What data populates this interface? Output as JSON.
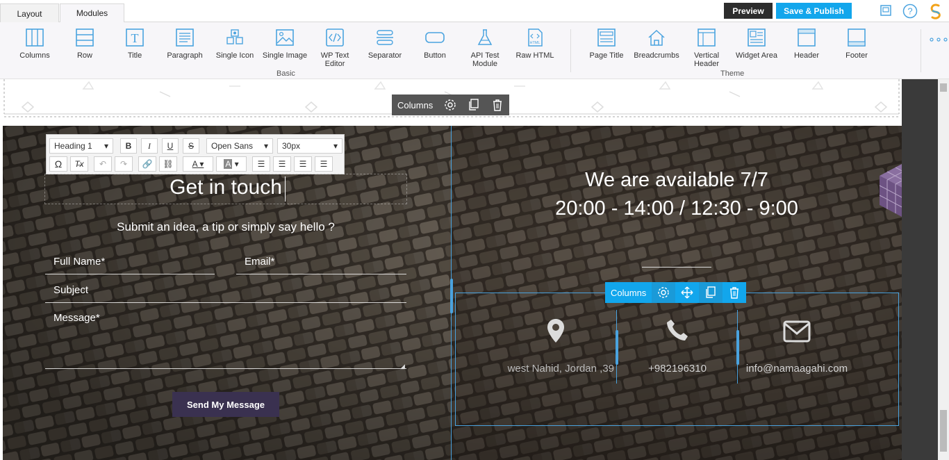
{
  "tabs": [
    {
      "label": "Layout"
    },
    {
      "label": "Modules"
    }
  ],
  "topbar": {
    "preview_label": "Preview",
    "publish_label": "Save & Publish"
  },
  "modules": {
    "basic": [
      {
        "label": "Columns",
        "icon": "columns-icon"
      },
      {
        "label": "Row",
        "icon": "row-icon"
      },
      {
        "label": "Title",
        "icon": "title-icon"
      },
      {
        "label": "Paragraph",
        "icon": "paragraph-icon"
      },
      {
        "label": "Single Icon",
        "icon": "single-icon-icon"
      },
      {
        "label": "Single Image",
        "icon": "image-icon"
      },
      {
        "label": "WP Text Editor",
        "icon": "code-icon"
      },
      {
        "label": "Separator",
        "icon": "separator-icon"
      },
      {
        "label": "Button",
        "icon": "button-icon"
      },
      {
        "label": "API Test Module",
        "icon": "flask-icon"
      },
      {
        "label": "Raw HTML",
        "icon": "html-file-icon"
      }
    ],
    "theme": [
      {
        "label": "Page Title",
        "icon": "page-title-icon"
      },
      {
        "label": "Breadcrumbs",
        "icon": "home-icon"
      },
      {
        "label": "Vertical Header",
        "icon": "vertical-header-icon"
      },
      {
        "label": "Widget Area",
        "icon": "widget-area-icon"
      },
      {
        "label": "Header",
        "icon": "header-icon"
      },
      {
        "label": "Footer",
        "icon": "footer-icon"
      }
    ],
    "basic_group": "Basic",
    "theme_group": "Theme"
  },
  "column_toolbar": {
    "label": "Columns"
  },
  "editor": {
    "format": "Heading 1",
    "font": "Open Sans",
    "size": "30px"
  },
  "contact": {
    "title": "Get in touch",
    "subtitle": "Submit an idea, a tip or simply say hello ?",
    "full_name_placeholder": "Full Name*",
    "email_placeholder": "Email*",
    "subject_placeholder": "Subject",
    "message_placeholder": "Message*",
    "send_label": "Send My Message"
  },
  "availability": {
    "line1": "We are available 7/7",
    "line2": "20:00 - 14:00 / 12:30 - 9:00"
  },
  "info": [
    {
      "icon": "map-marker-icon",
      "text": "west Nahid, Jordan ,39"
    },
    {
      "icon": "phone-icon",
      "text": "+982196310"
    },
    {
      "icon": "envelope-icon",
      "text": "info@namaagahi.com"
    }
  ],
  "colors": {
    "accent": "#12a6ec",
    "dark_toolbar": "#555555",
    "send_button": "#3a3150"
  }
}
